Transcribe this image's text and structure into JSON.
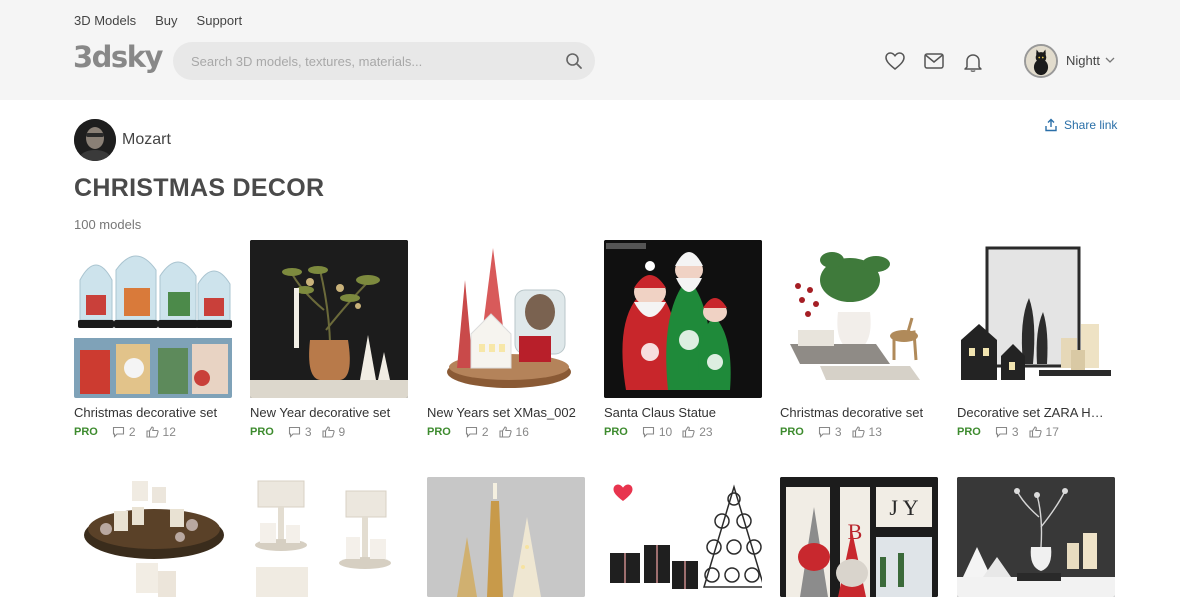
{
  "nav": {
    "items": [
      "3D Models",
      "Buy",
      "Support"
    ]
  },
  "logo": {
    "text": "3dsky"
  },
  "search": {
    "placeholder": "Search 3D models, textures, materials..."
  },
  "user": {
    "name": "Nightt"
  },
  "author": {
    "name": "Mozart"
  },
  "share": {
    "label": "Share link"
  },
  "collection": {
    "title": "CHRISTMAS DECOR",
    "count": "100 models"
  },
  "colors": {
    "pro": "#3d8b2e",
    "link": "#2a6fa8",
    "header_bg": "#f5f5f5",
    "favorite": "#e8344e"
  },
  "models": [
    {
      "name": "Christmas decorative set",
      "badge": "PRO",
      "comments": "2",
      "likes": "12"
    },
    {
      "name": "New Year decorative set",
      "badge": "PRO",
      "comments": "3",
      "likes": "9"
    },
    {
      "name": "New Years set XMas_002",
      "badge": "PRO",
      "comments": "2",
      "likes": "16"
    },
    {
      "name": "Santa Claus Statue",
      "badge": "PRO",
      "comments": "10",
      "likes": "23"
    },
    {
      "name": "Christmas decorative set",
      "badge": "PRO",
      "comments": "3",
      "likes": "13"
    },
    {
      "name": "Decorative set ZARA HOME",
      "badge": "PRO",
      "comments": "3",
      "likes": "17"
    }
  ]
}
